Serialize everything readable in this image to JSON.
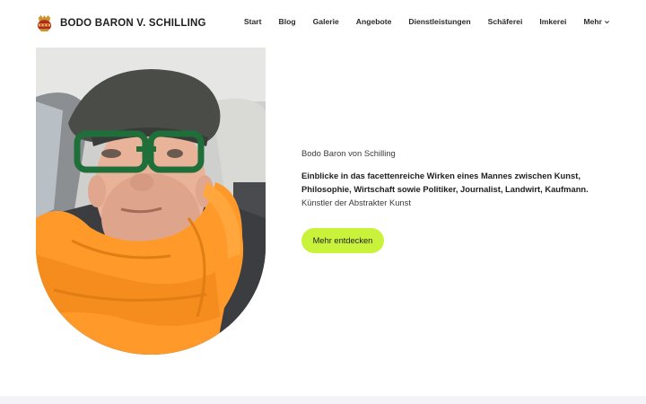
{
  "header": {
    "site_title": "BODO BARON V. SCHILLING",
    "logo_icon": "crest-icon"
  },
  "nav": {
    "items": [
      {
        "label": "Start"
      },
      {
        "label": "Blog"
      },
      {
        "label": "Galerie"
      },
      {
        "label": "Angebote"
      },
      {
        "label": "Dienstleistungen"
      },
      {
        "label": "Schäferei"
      },
      {
        "label": "Imkerei"
      },
      {
        "label": "Mehr",
        "icon": "chevron-down-icon"
      }
    ]
  },
  "hero": {
    "name": "Bodo Baron von Schilling",
    "description_bold": "Einblicke in das facettenreiche Wirken eines Mannes zwischen Kunst, Philosophie, Wirtschaft sowie Politiker, Journalist, Landwirt, Kaufmann.",
    "description_regular": "Künstler der Abstrakter Kunst",
    "cta_label": "Mehr entdecken"
  },
  "colors": {
    "accent": "#c9f23a",
    "scarf": "#ff9a2a",
    "footer_band": "#f4f4f8"
  }
}
